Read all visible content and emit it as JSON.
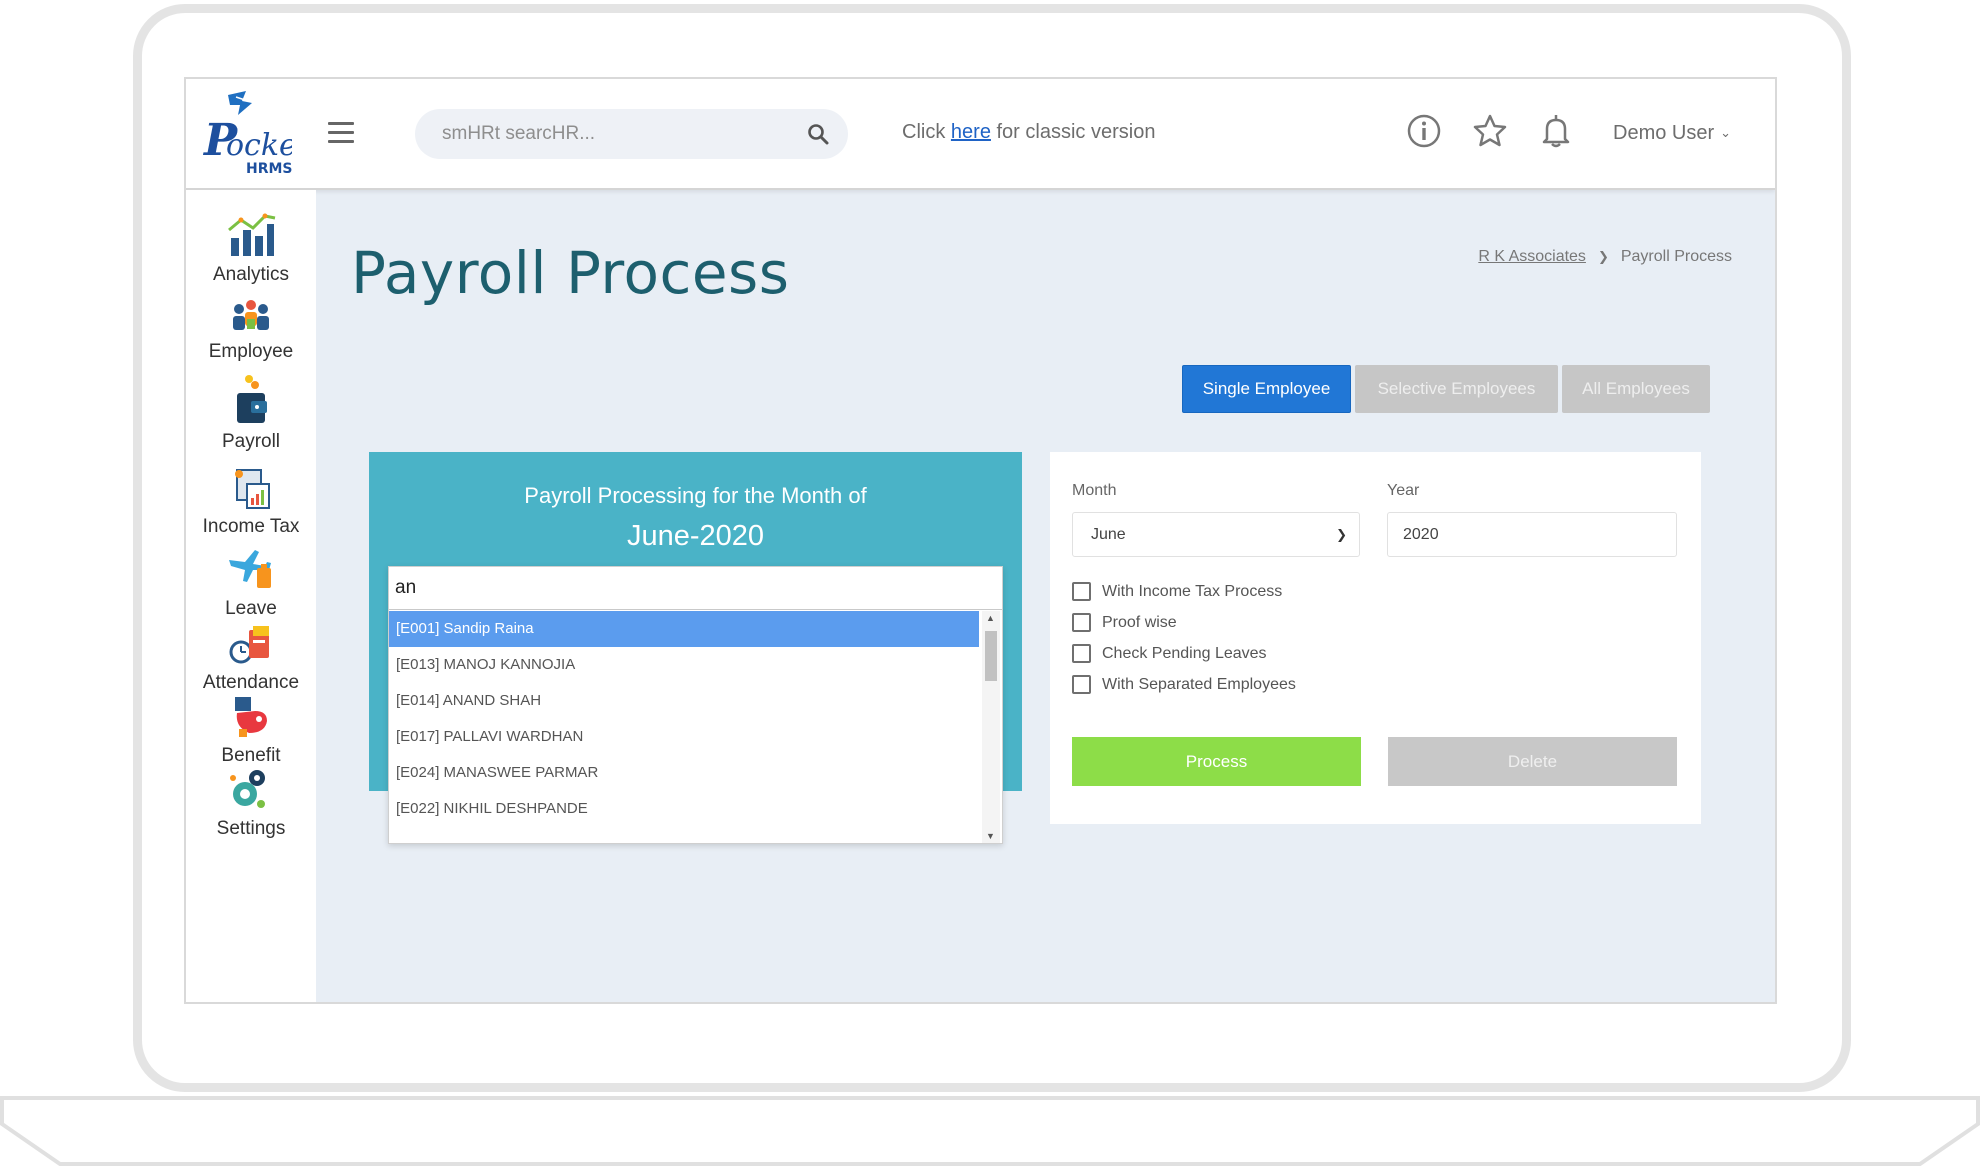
{
  "header": {
    "logo_text": "Pocket",
    "logo_subtext": "HRMS",
    "search_placeholder": "smHRt searcHR...",
    "classic_prefix": "Click",
    "classic_link": "here",
    "classic_suffix": "for classic version",
    "user_name": "Demo User",
    "icons": [
      "info-icon",
      "star-icon",
      "bell-icon"
    ]
  },
  "sidebar": {
    "items": [
      {
        "label": "Analytics",
        "icon": "analytics-icon"
      },
      {
        "label": "Employee",
        "icon": "employee-icon"
      },
      {
        "label": "Payroll",
        "icon": "payroll-icon"
      },
      {
        "label": "Income Tax",
        "icon": "income-tax-icon"
      },
      {
        "label": "Leave",
        "icon": "leave-icon"
      },
      {
        "label": "Attendance",
        "icon": "attendance-icon"
      },
      {
        "label": "Benefit",
        "icon": "benefit-icon"
      },
      {
        "label": "Settings",
        "icon": "settings-icon"
      }
    ]
  },
  "main": {
    "title": "Payroll Process",
    "breadcrumb": {
      "parent": "R K Associates",
      "current": "Payroll Process"
    },
    "modes": [
      "Single Employee",
      "Selective Employees",
      "All Employees"
    ],
    "month_card": {
      "subtitle": "Payroll Processing for the Month of",
      "period": "June-2020"
    },
    "employee_search": {
      "value": "an",
      "options": [
        "[E001] Sandip Raina",
        "[E013] MANOJ KANNOJIA",
        "[E014] ANAND SHAH",
        "[E017] PALLAVI WARDHAN",
        "[E024] MANASWEE PARMAR",
        "[E022] NIKHIL DESHPANDE"
      ]
    },
    "options_card": {
      "month_label": "Month",
      "month_value": "June",
      "year_label": "Year",
      "year_value": "2020",
      "checks": [
        "With Income Tax Process",
        "Proof wise",
        "Check Pending Leaves",
        "With Separated Employees"
      ],
      "process_label": "Process",
      "delete_label": "Delete"
    }
  },
  "colors": {
    "title": "#1d5f6e",
    "active_mode": "#2177d6",
    "card_teal": "#4ab3c7",
    "highlight": "#5b9cee",
    "process": "#8ddd48"
  }
}
